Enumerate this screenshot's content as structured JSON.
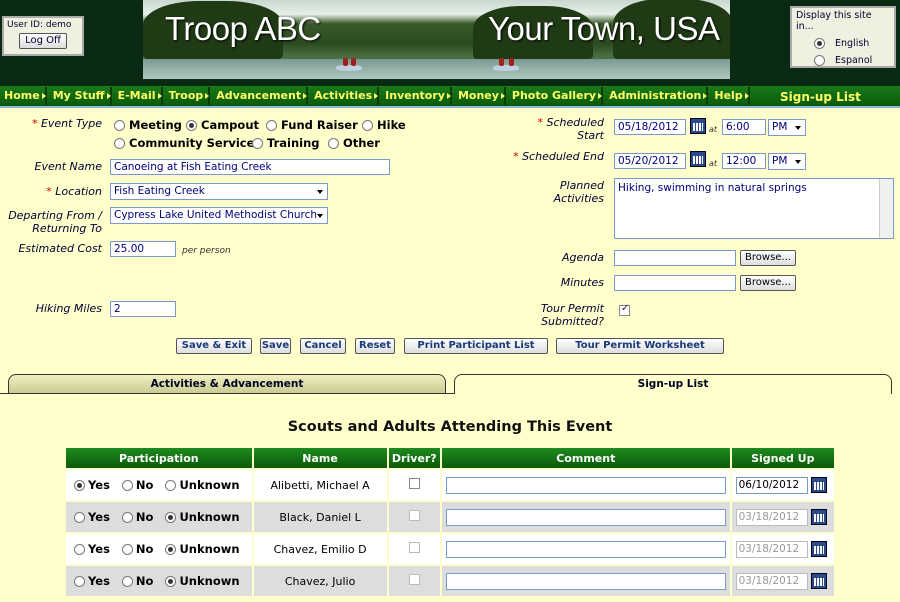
{
  "header": {
    "user_label": "User ID:",
    "user_id": "demo",
    "logoff_label": "Log Off",
    "banner_left": "Troop ABC",
    "banner_right": "Your Town, USA",
    "lang_title": "Display this site in...",
    "lang_options": [
      "English",
      "Espanol"
    ],
    "lang_selected": "English"
  },
  "nav": {
    "items": [
      "Home",
      "My Stuff",
      "E-Mail",
      "Troop",
      "Advancement",
      "Activities",
      "Inventory",
      "Money",
      "Photo Gallery",
      "Administration",
      "Help"
    ],
    "page_title": "Sign-up List"
  },
  "form": {
    "event_type_label": "Event Type",
    "event_types": [
      "Meeting",
      "Campout",
      "Fund Raiser",
      "Hike",
      "Community Service",
      "Training",
      "Other"
    ],
    "event_type_selected": "Campout",
    "event_name_label": "Event Name",
    "event_name": "Canoeing at Fish Eating Creek",
    "location_label": "Location",
    "location": "Fish Eating Creek",
    "departing_label_1": "Departing From /",
    "departing_label_2": "Returning To",
    "departing": "Cypress Lake United Methodist Church",
    "cost_label": "Estimated Cost",
    "cost": "25.00",
    "cost_unit": "per person",
    "miles_label": "Hiking Miles",
    "miles": "2",
    "start_label_1": "Scheduled",
    "start_label_2": "Start",
    "start_date": "05/18/2012",
    "start_time": "6:00",
    "start_ampm": "PM",
    "end_label": "Scheduled End",
    "end_date": "05/20/2012",
    "end_time": "12:00",
    "end_ampm": "PM",
    "at": "at",
    "planned_label_1": "Planned",
    "planned_label_2": "Activities",
    "planned": "Hiking, swimming in natural springs",
    "agenda_label": "Agenda",
    "minutes_label": "Minutes",
    "browse": "Browse...",
    "permit_label_1": "Tour Permit",
    "permit_label_2": "Submitted?",
    "permit_checked": true
  },
  "buttons": {
    "save_exit": "Save & Exit",
    "save": "Save",
    "cancel": "Cancel",
    "reset": "Reset",
    "print": "Print Participant List",
    "worksheet": "Tour Permit Worksheet"
  },
  "tabs": {
    "activities": "Activities & Advancement",
    "signup": "Sign-up List"
  },
  "section_title": "Scouts and Adults Attending This Event",
  "table": {
    "headers": [
      "Participation",
      "Name",
      "Driver?",
      "Comment",
      "Signed Up"
    ],
    "options": [
      "Yes",
      "No",
      "Unknown"
    ],
    "rows": [
      {
        "participation": "Yes",
        "name": "Alibetti, Michael A",
        "date": "06/10/2012",
        "active": true
      },
      {
        "participation": "Unknown",
        "name": "Black, Daniel L",
        "date": "03/18/2012",
        "active": false
      },
      {
        "participation": "Unknown",
        "name": "Chavez, Emilio D",
        "date": "03/18/2012",
        "active": false
      },
      {
        "participation": "Unknown",
        "name": "Chavez, Julio",
        "date": "03/18/2012",
        "active": false
      }
    ]
  },
  "colors": {
    "nav_green": "#0a5a0a",
    "nav_text": "#ffff66",
    "bg": "#ffffcc"
  }
}
